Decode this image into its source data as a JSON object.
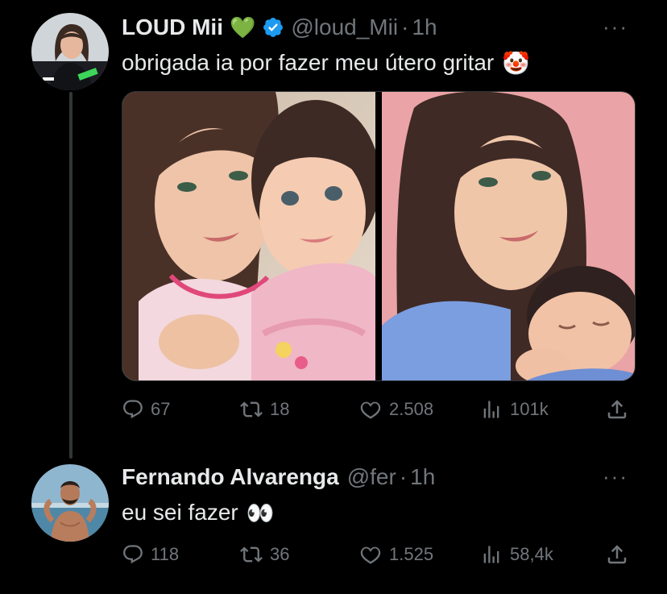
{
  "tweets": [
    {
      "display_name": "LOUD Mii",
      "name_badge": "💚",
      "verified_icon": "verified-badge-icon",
      "handle": "@loud_Mii",
      "separator": "·",
      "time": "1h",
      "more": "···",
      "text": "obrigada ia por fazer meu útero gritar",
      "text_emoji": "🤡",
      "media_count": 2,
      "replies": "67",
      "retweets": "18",
      "likes": "2.508",
      "views": "101k"
    },
    {
      "display_name": "Fernando Alvarenga",
      "handle": "@fer",
      "separator": "·",
      "time": "1h",
      "more": "···",
      "text": "eu sei fazer",
      "text_emoji": "👀",
      "replies": "118",
      "retweets": "36",
      "likes": "1.525",
      "views": "58,4k"
    }
  ],
  "icons": {
    "reply": "reply-icon",
    "retweet": "retweet-icon",
    "like": "heart-icon",
    "views": "views-icon",
    "share": "share-icon"
  },
  "colors": {
    "background": "#000000",
    "text": "#e7e9ea",
    "muted": "#71767b",
    "verified": "#1d9bf0",
    "thread_line": "#333639"
  }
}
